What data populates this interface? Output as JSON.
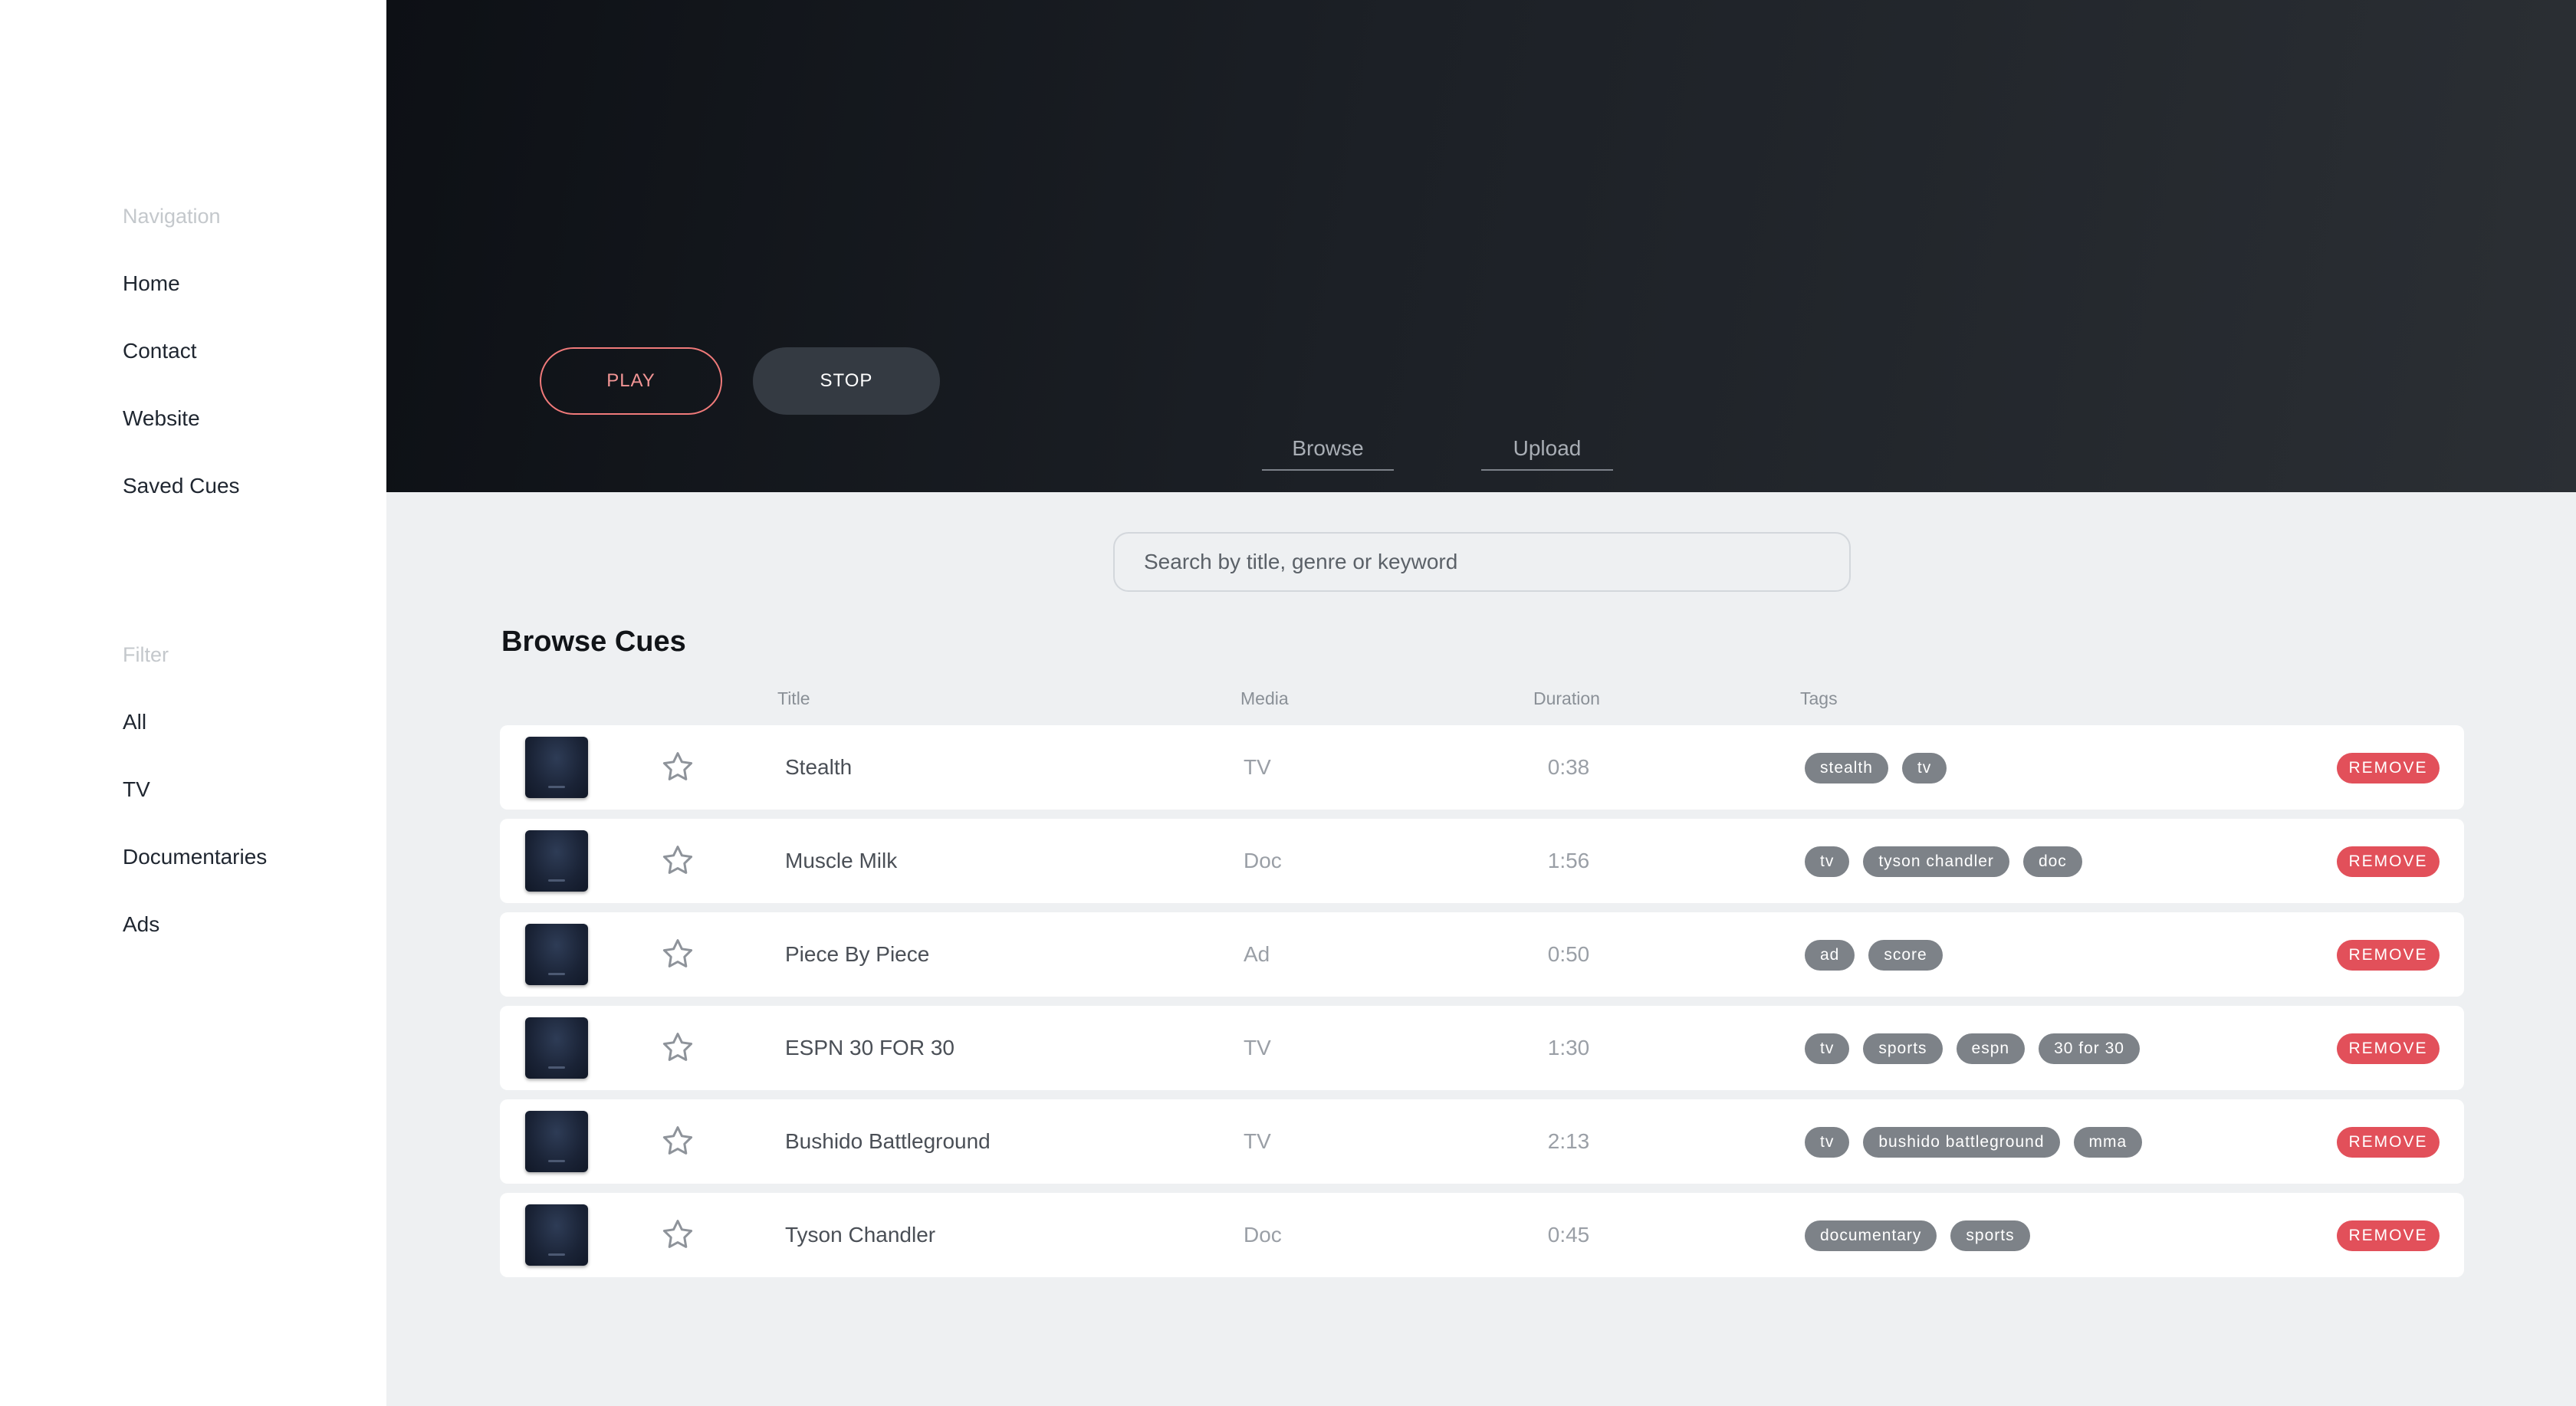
{
  "sidebar": {
    "navigation_heading": "Navigation",
    "navigation_items": [
      "Home",
      "Contact",
      "Website",
      "Saved Cues"
    ],
    "filter_heading": "Filter",
    "filter_items": [
      "All",
      "TV",
      "Documentaries",
      "Ads"
    ]
  },
  "player": {
    "play_label": "PLAY",
    "stop_label": "STOP"
  },
  "tabs": [
    "Browse",
    "Upload"
  ],
  "search": {
    "placeholder": "Search by title, genre or keyword",
    "value": ""
  },
  "browse": {
    "title": "Browse Cues",
    "columns": {
      "title": "Title",
      "media": "Media",
      "duration": "Duration",
      "tags": "Tags"
    },
    "remove_label": "REMOVE",
    "rows": [
      {
        "title": "Stealth",
        "media": "TV",
        "duration": "0:38",
        "tags": [
          "stealth",
          "tv"
        ]
      },
      {
        "title": "Muscle Milk",
        "media": "Doc",
        "duration": "1:56",
        "tags": [
          "tv",
          "tyson chandler",
          "doc"
        ]
      },
      {
        "title": "Piece By Piece",
        "media": "Ad",
        "duration": "0:50",
        "tags": [
          "ad",
          "score"
        ]
      },
      {
        "title": "ESPN 30 FOR 30",
        "media": "TV",
        "duration": "1:30",
        "tags": [
          "tv",
          "sports",
          "espn",
          "30 for 30"
        ]
      },
      {
        "title": "Bushido Battleground",
        "media": "TV",
        "duration": "2:13",
        "tags": [
          "tv",
          "bushido battleground",
          "mma"
        ]
      },
      {
        "title": "Tyson Chandler",
        "media": "Doc",
        "duration": "0:45",
        "tags": [
          "documentary",
          "sports"
        ]
      }
    ]
  },
  "icons": {
    "favorite": "star-outline-icon",
    "thumbnail": "cue-thumbnail"
  },
  "colors": {
    "accent_play": "#f07a7a",
    "remove": "#e2505a",
    "tag": "#7d8288",
    "hero_dark": "#0d1015"
  }
}
